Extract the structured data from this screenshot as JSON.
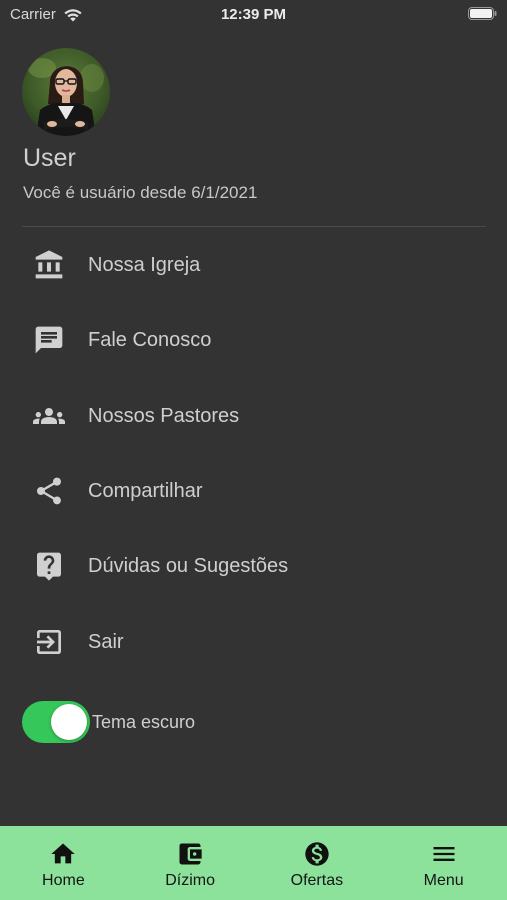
{
  "status_bar": {
    "carrier": "Carrier",
    "time": "12:39 PM"
  },
  "profile": {
    "name": "User",
    "member_since": "Você é usuário desde 6/1/2021"
  },
  "menu": {
    "items": [
      {
        "label": "Nossa Igreja",
        "icon": "bank-icon"
      },
      {
        "label": "Fale Conosco",
        "icon": "message-icon"
      },
      {
        "label": "Nossos Pastores",
        "icon": "people-icon"
      },
      {
        "label": "Compartilhar",
        "icon": "share-icon"
      },
      {
        "label": "Dúvidas ou Sugestões",
        "icon": "help-icon"
      },
      {
        "label": "Sair",
        "icon": "exit-icon"
      }
    ]
  },
  "theme_toggle": {
    "label": "Tema escuro",
    "on": true
  },
  "tab_bar": {
    "tabs": [
      {
        "label": "Home",
        "icon": "home-icon"
      },
      {
        "label": "Dízimo",
        "icon": "wallet-icon"
      },
      {
        "label": "Ofertas",
        "icon": "dollar-icon"
      },
      {
        "label": "Menu",
        "icon": "menu-icon"
      }
    ]
  },
  "colors": {
    "background": "#333333",
    "tab_bar": "#8ce29a",
    "toggle_on": "#35c759",
    "text": "#cfcfcf"
  }
}
